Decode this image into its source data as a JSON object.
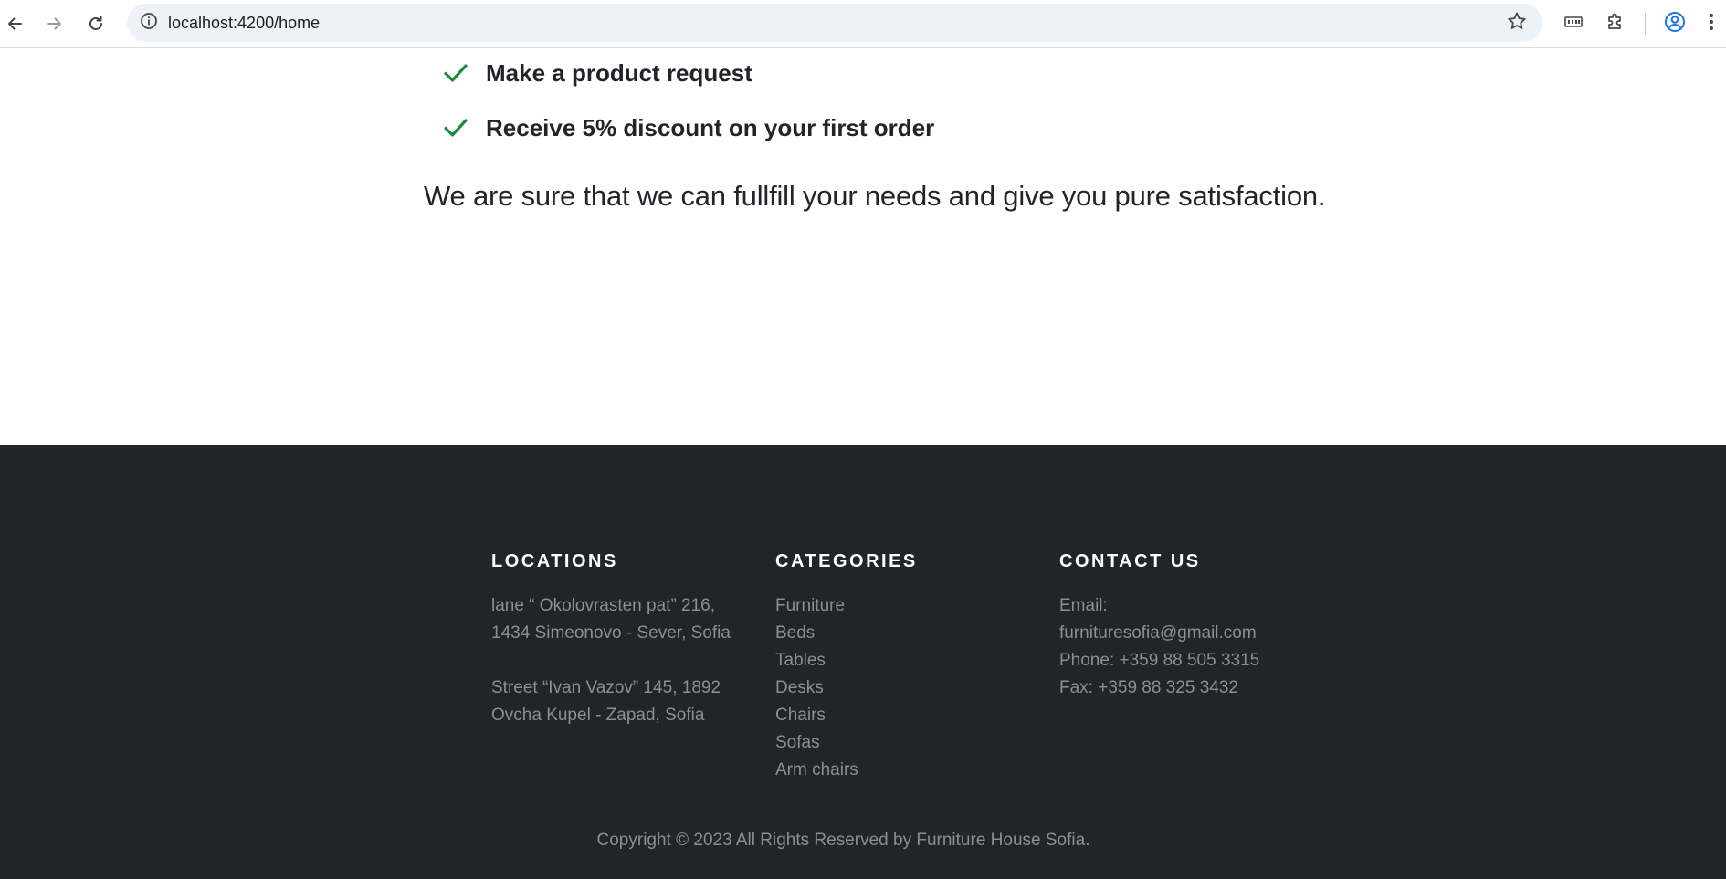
{
  "browser": {
    "url": "localhost:4200/home",
    "icons": {
      "back": "arrow-left-icon",
      "forward": "arrow-right-icon",
      "reload": "reload-icon",
      "site_info": "info-icon",
      "bookmark": "star-icon",
      "media": "media-controls-icon",
      "extensions": "puzzle-icon",
      "profile": "account-icon",
      "menu": "more-vertical-icon"
    },
    "colors": {
      "omnibox_bg": "#edf1f8",
      "profile_accent": "#1a73e8"
    }
  },
  "benefits": {
    "items": [
      {
        "text": "Make a product request"
      },
      {
        "text": "Receive 5% discount on your first order"
      }
    ],
    "check_color": "#1e8a3c"
  },
  "satisfaction_text": "We are sure that we can fullfill your needs and give you pure satisfaction.",
  "footer": {
    "background": "#212429",
    "locations": {
      "title": "LOCATIONS",
      "address1_line1": "lane “ Okolovrasten pat” 216,",
      "address1_line2": "1434 Simeonovo - Sever, Sofia",
      "address2_line1": "Street “Ivan Vazov” 145, 1892",
      "address2_line2": "Ovcha Kupel - Zapad, Sofia"
    },
    "categories": {
      "title": "CATEGORIES",
      "items": [
        "Furniture",
        "Beds",
        "Tables",
        "Desks",
        "Chairs",
        "Sofas",
        "Arm chairs"
      ]
    },
    "contact": {
      "title": "CONTACT US",
      "email_label": "Email:",
      "email": "furnituresofia@gmail.com",
      "phone": "Phone: +359 88 505 3315",
      "fax": "Fax: +359 88 325 3432"
    },
    "copyright": {
      "prefix": "Copyright © 2023 All Rights Reserved by ",
      "brand": "Furniture House Sofia",
      "suffix": "."
    }
  }
}
